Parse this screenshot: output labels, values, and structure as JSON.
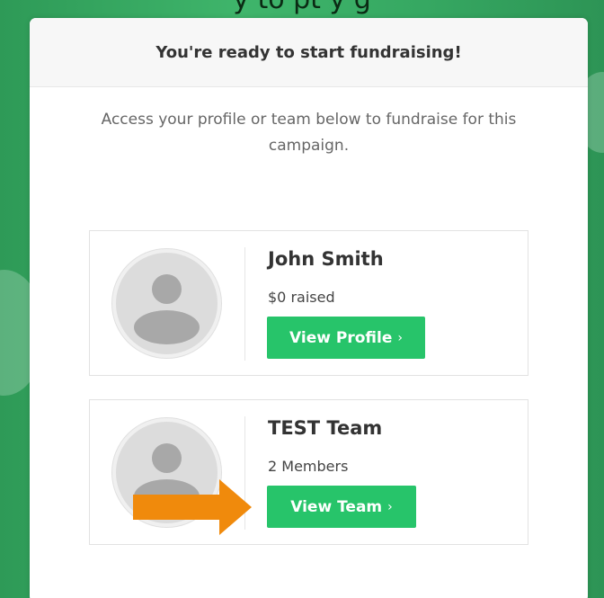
{
  "background": {
    "partial_text": "y   to    pt      y   g"
  },
  "modal": {
    "title": "You're ready to start fundraising!",
    "intro": "Access your profile or team below to fundraise for this campaign."
  },
  "cards": [
    {
      "name": "John Smith",
      "subtitle": "$0 raised",
      "button_label": "View Profile",
      "button_chevron": "›",
      "avatar_icon": "user-silhouette-icon"
    },
    {
      "name": "TEST Team",
      "subtitle": "2 Members",
      "button_label": "View Team",
      "button_chevron": "›",
      "avatar_icon": "user-silhouette-icon"
    }
  ],
  "annotation": {
    "arrow_color": "#f08a0c",
    "icon": "arrow-right-icon"
  },
  "colors": {
    "button": "#27c46a",
    "background": "#3fb56b"
  }
}
